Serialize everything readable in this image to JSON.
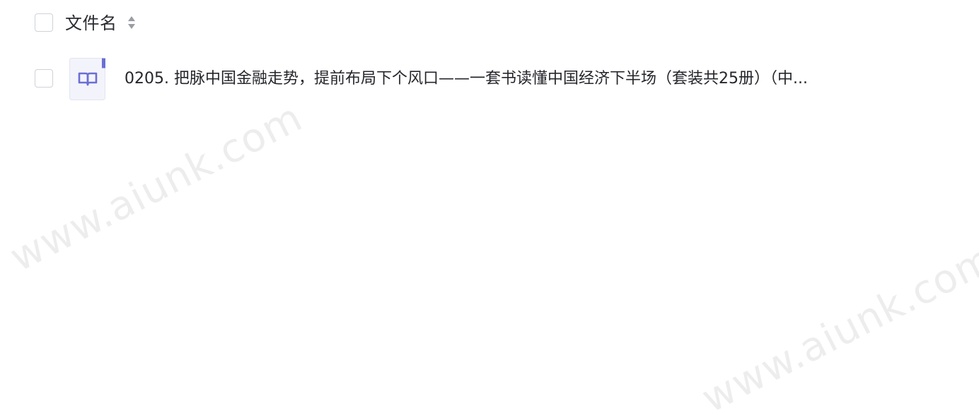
{
  "header": {
    "column_label": "文件名",
    "sort_icon": "sort-updown-icon"
  },
  "files": [
    {
      "name": "0205. 把脉中国金融走势，提前布局下个风口——一套书读懂中国经济下半场（套装共25册）（中...",
      "icon": "book-file-icon"
    }
  ],
  "watermark": {
    "text": "www.aiunk.com"
  },
  "colors": {
    "checkbox_border": "#cfd2d8",
    "text": "#25262b",
    "icon_accent": "#6b6fd4",
    "icon_bg": "#f3f3fb"
  }
}
